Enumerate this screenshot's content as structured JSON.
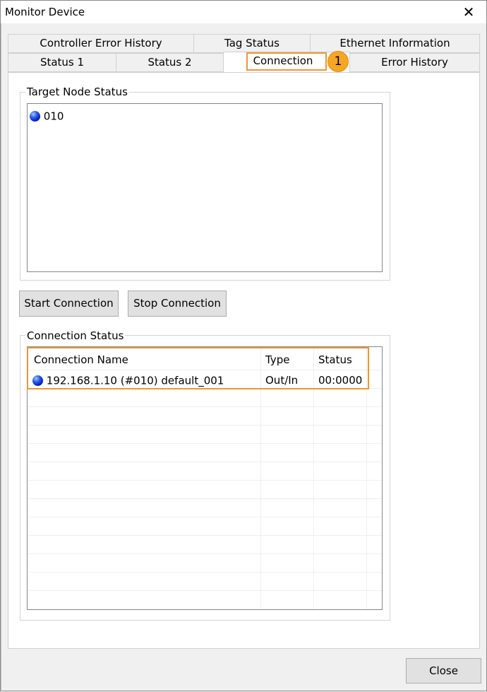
{
  "window": {
    "title": "Monitor Device",
    "close_glyph": "✕"
  },
  "tabs": {
    "row_back": [
      {
        "label": "Controller Error History"
      },
      {
        "label": "Tag Status"
      },
      {
        "label": "Ethernet Information"
      }
    ],
    "row_front": [
      {
        "label": "Status 1"
      },
      {
        "label": "Status 2"
      },
      {
        "label": "Connection",
        "active": true
      },
      {
        "label": "Error History"
      }
    ]
  },
  "callout": {
    "number": "1",
    "color": "#f0962f"
  },
  "target_node_status": {
    "label": "Target Node Status",
    "nodes": [
      {
        "id": "010",
        "icon": "blue-status-dot"
      }
    ]
  },
  "buttons": {
    "start_connection": "Start Connection",
    "stop_connection": "Stop Connection",
    "close": "Close"
  },
  "connection_status": {
    "label": "Connection Status",
    "columns": [
      "Connection Name",
      "Type",
      "Status"
    ],
    "rows": [
      {
        "name": "192.168.1.10 (#010) default_001",
        "type": "Out/In",
        "status": "00:0000",
        "icon": "blue-status-dot"
      }
    ]
  }
}
